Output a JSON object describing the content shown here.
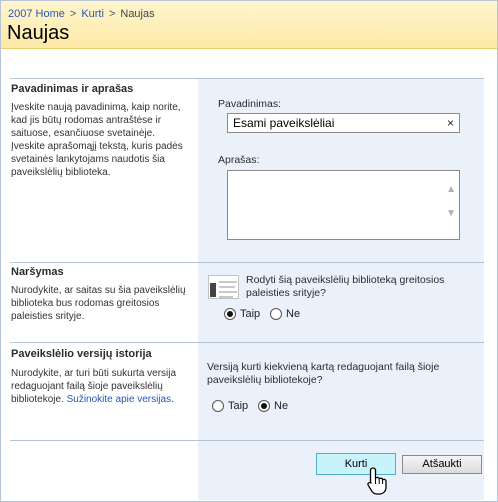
{
  "breadcrumb": {
    "home": "2007 Home",
    "separator": ">",
    "parent": "Kurti",
    "current": "Naujas"
  },
  "page_title": "Naujas",
  "sections": {
    "name": {
      "title": "Pavadinimas ir aprašas",
      "description": "Įveskite naują pavadinimą, kaip norite, kad jis būtų rodomas antraštėse ir saituose, esančiuose svetainėje. Įveskite aprašomąjį tekstą, kuris padės svetainės lankytojams naudotis šia paveikslėlių biblioteka.",
      "name_label": "Pavadinimas:",
      "name_value": "Esami paveikslėliai",
      "clear_icon": "×",
      "description_label": "Aprašas:",
      "description_value": ""
    },
    "navigation": {
      "title": "Naršymas",
      "description": "Nurodykite, ar saitas su šia paveikslėlių biblioteka bus rodomas greitosios paleisties srityje.",
      "question": "Rodyti šią paveikslėlių biblioteką greitosios paleisties srityje?",
      "icon": "quick-launch-icon",
      "yes_label": "Taip",
      "no_label": "Ne",
      "selected": "yes"
    },
    "versioning": {
      "title": "Paveikslėlio versijų istorija",
      "description": "Nurodykite, ar turi būti sukurta versija redaguojant failą šioje paveikslėlių bibliotekoje.",
      "link": "Sužinokite apie versijas.",
      "question": "Versiją kurti kiekvieną kartą redaguojant failą šioje paveikslėlių bibliotekoje?",
      "yes_label": "Taip",
      "no_label": "Ne",
      "selected": "no"
    }
  },
  "buttons": {
    "create": "Kurti",
    "cancel": "Atšaukti"
  },
  "colors": {
    "header_bg": "#fde9a6",
    "panel_bg": "#eaf1fb",
    "link": "#2a56b5",
    "create_button": "#c9f3fb"
  }
}
